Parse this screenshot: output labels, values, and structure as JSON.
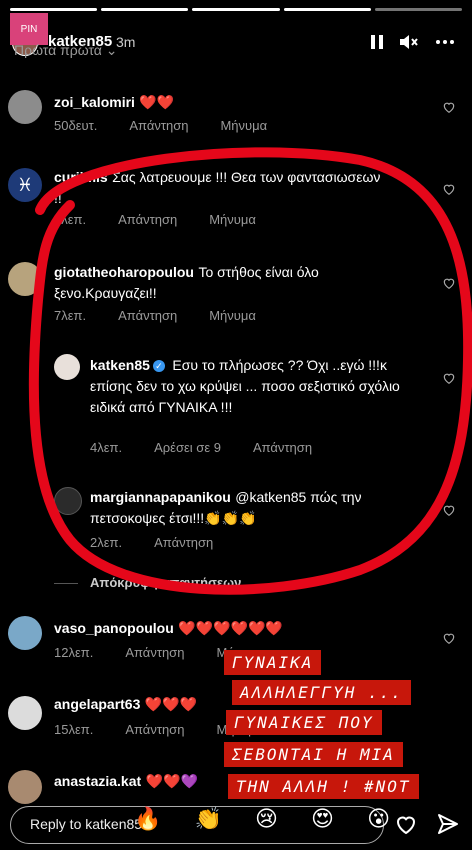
{
  "header": {
    "pin_label": "PIN",
    "username": "katken85",
    "time": "3m",
    "sort_label": "Πρώτα πρώτα",
    "pause_icon": "pause-icon",
    "mute_icon": "mute-icon",
    "more_icon": "more-icon"
  },
  "comments": [
    {
      "user": "zoi_kalomiri",
      "text": "❤️❤️",
      "time": "50δευτ.",
      "reply": "Απάντηση",
      "message": "Μήνυμα"
    },
    {
      "user": "curjimis",
      "text": "Σας λατρευουμε !!! Θεα των φαντασιωσεων !!",
      "time": "6λεπ.",
      "reply": "Απάντηση",
      "message": "Μήνυμα"
    },
    {
      "user": "giotatheoharopoulou",
      "text": "Το στήθος είναι όλο ξενο.Κραυγαζει!!",
      "time": "7λεπ.",
      "reply": "Απάντηση",
      "message": "Μήνυμα"
    },
    {
      "user": "vaso_panopoulou",
      "text": "❤️❤️❤️❤️❤️❤️",
      "time": "12λεπ.",
      "reply": "Απάντηση",
      "message": "Μήνυμα"
    },
    {
      "user": "angelapart63",
      "text": "❤️❤️❤️",
      "time": "15λεπ.",
      "reply": "Απάντηση",
      "message": "Μήνυμα"
    },
    {
      "user": "anastazia.kat",
      "text": "❤️❤️💜"
    }
  ],
  "replies": [
    {
      "user": "katken85",
      "text": "Εσυ το πλήρωσες ?? Όχι ..εγώ !!!κ επίσης δεν το χω κρύψει ... ποσο σεξιστικό σχόλιο ειδικά από ΓΥΝΑΙΚΑ !!!",
      "time": "4λεπ.",
      "likes": "Αρέσει σε 9",
      "reply": "Απάντηση"
    },
    {
      "user": "margiannapapanikou",
      "text": "@katken85 πώς την πετσοκοψες έτσι!!!👏👏👏",
      "time": "2λεπ.",
      "reply": "Απάντηση"
    }
  ],
  "hide_replies": "Απόκρυψη απαντήσεων",
  "sticker_lines": [
    "ΓΥΝΑΙΚΑ",
    "ΑΛΛΗΛΕΓΓΥΗ ...",
    "ΓΥΝΑΙΚΕΣ ΠΟΥ",
    "ΣΕΒΟΝΤΑΙ Η ΜΙΑ",
    "ΤΗΝ ΑΛΛΗ ! #NOT"
  ],
  "reply_placeholder": "Reply to katken85...",
  "emojis": [
    "🔥",
    "👏",
    "😢",
    "😍",
    "😮"
  ],
  "colors": {
    "scribble": "#e5071a",
    "sticker_bg": "#c7170b",
    "verified": "#3897f0"
  }
}
